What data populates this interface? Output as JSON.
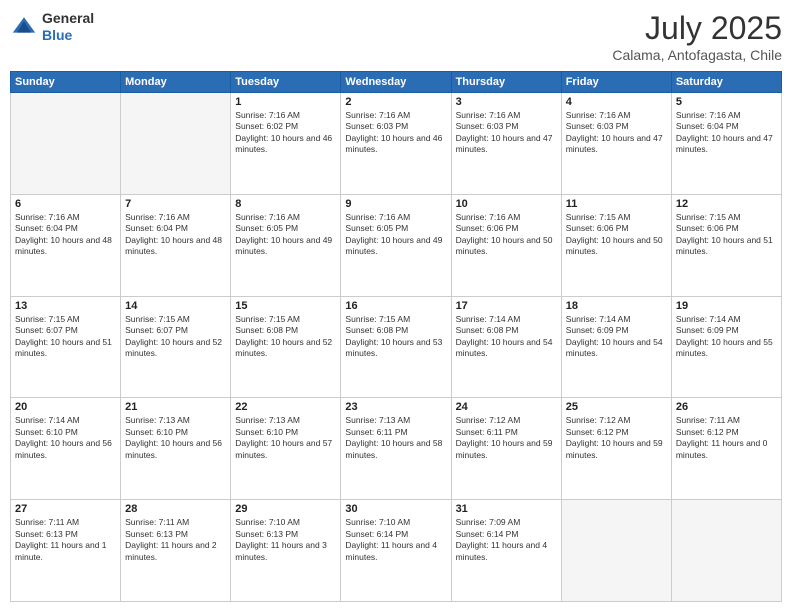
{
  "header": {
    "logo_general": "General",
    "logo_blue": "Blue",
    "month_year": "July 2025",
    "location": "Calama, Antofagasta, Chile"
  },
  "days_of_week": [
    "Sunday",
    "Monday",
    "Tuesday",
    "Wednesday",
    "Thursday",
    "Friday",
    "Saturday"
  ],
  "weeks": [
    [
      {
        "day": "",
        "empty": true
      },
      {
        "day": "",
        "empty": true
      },
      {
        "day": "1",
        "sunrise": "Sunrise: 7:16 AM",
        "sunset": "Sunset: 6:02 PM",
        "daylight": "Daylight: 10 hours and 46 minutes."
      },
      {
        "day": "2",
        "sunrise": "Sunrise: 7:16 AM",
        "sunset": "Sunset: 6:03 PM",
        "daylight": "Daylight: 10 hours and 46 minutes."
      },
      {
        "day": "3",
        "sunrise": "Sunrise: 7:16 AM",
        "sunset": "Sunset: 6:03 PM",
        "daylight": "Daylight: 10 hours and 47 minutes."
      },
      {
        "day": "4",
        "sunrise": "Sunrise: 7:16 AM",
        "sunset": "Sunset: 6:03 PM",
        "daylight": "Daylight: 10 hours and 47 minutes."
      },
      {
        "day": "5",
        "sunrise": "Sunrise: 7:16 AM",
        "sunset": "Sunset: 6:04 PM",
        "daylight": "Daylight: 10 hours and 47 minutes."
      }
    ],
    [
      {
        "day": "6",
        "sunrise": "Sunrise: 7:16 AM",
        "sunset": "Sunset: 6:04 PM",
        "daylight": "Daylight: 10 hours and 48 minutes."
      },
      {
        "day": "7",
        "sunrise": "Sunrise: 7:16 AM",
        "sunset": "Sunset: 6:04 PM",
        "daylight": "Daylight: 10 hours and 48 minutes."
      },
      {
        "day": "8",
        "sunrise": "Sunrise: 7:16 AM",
        "sunset": "Sunset: 6:05 PM",
        "daylight": "Daylight: 10 hours and 49 minutes."
      },
      {
        "day": "9",
        "sunrise": "Sunrise: 7:16 AM",
        "sunset": "Sunset: 6:05 PM",
        "daylight": "Daylight: 10 hours and 49 minutes."
      },
      {
        "day": "10",
        "sunrise": "Sunrise: 7:16 AM",
        "sunset": "Sunset: 6:06 PM",
        "daylight": "Daylight: 10 hours and 50 minutes."
      },
      {
        "day": "11",
        "sunrise": "Sunrise: 7:15 AM",
        "sunset": "Sunset: 6:06 PM",
        "daylight": "Daylight: 10 hours and 50 minutes."
      },
      {
        "day": "12",
        "sunrise": "Sunrise: 7:15 AM",
        "sunset": "Sunset: 6:06 PM",
        "daylight": "Daylight: 10 hours and 51 minutes."
      }
    ],
    [
      {
        "day": "13",
        "sunrise": "Sunrise: 7:15 AM",
        "sunset": "Sunset: 6:07 PM",
        "daylight": "Daylight: 10 hours and 51 minutes."
      },
      {
        "day": "14",
        "sunrise": "Sunrise: 7:15 AM",
        "sunset": "Sunset: 6:07 PM",
        "daylight": "Daylight: 10 hours and 52 minutes."
      },
      {
        "day": "15",
        "sunrise": "Sunrise: 7:15 AM",
        "sunset": "Sunset: 6:08 PM",
        "daylight": "Daylight: 10 hours and 52 minutes."
      },
      {
        "day": "16",
        "sunrise": "Sunrise: 7:15 AM",
        "sunset": "Sunset: 6:08 PM",
        "daylight": "Daylight: 10 hours and 53 minutes."
      },
      {
        "day": "17",
        "sunrise": "Sunrise: 7:14 AM",
        "sunset": "Sunset: 6:08 PM",
        "daylight": "Daylight: 10 hours and 54 minutes."
      },
      {
        "day": "18",
        "sunrise": "Sunrise: 7:14 AM",
        "sunset": "Sunset: 6:09 PM",
        "daylight": "Daylight: 10 hours and 54 minutes."
      },
      {
        "day": "19",
        "sunrise": "Sunrise: 7:14 AM",
        "sunset": "Sunset: 6:09 PM",
        "daylight": "Daylight: 10 hours and 55 minutes."
      }
    ],
    [
      {
        "day": "20",
        "sunrise": "Sunrise: 7:14 AM",
        "sunset": "Sunset: 6:10 PM",
        "daylight": "Daylight: 10 hours and 56 minutes."
      },
      {
        "day": "21",
        "sunrise": "Sunrise: 7:13 AM",
        "sunset": "Sunset: 6:10 PM",
        "daylight": "Daylight: 10 hours and 56 minutes."
      },
      {
        "day": "22",
        "sunrise": "Sunrise: 7:13 AM",
        "sunset": "Sunset: 6:10 PM",
        "daylight": "Daylight: 10 hours and 57 minutes."
      },
      {
        "day": "23",
        "sunrise": "Sunrise: 7:13 AM",
        "sunset": "Sunset: 6:11 PM",
        "daylight": "Daylight: 10 hours and 58 minutes."
      },
      {
        "day": "24",
        "sunrise": "Sunrise: 7:12 AM",
        "sunset": "Sunset: 6:11 PM",
        "daylight": "Daylight: 10 hours and 59 minutes."
      },
      {
        "day": "25",
        "sunrise": "Sunrise: 7:12 AM",
        "sunset": "Sunset: 6:12 PM",
        "daylight": "Daylight: 10 hours and 59 minutes."
      },
      {
        "day": "26",
        "sunrise": "Sunrise: 7:11 AM",
        "sunset": "Sunset: 6:12 PM",
        "daylight": "Daylight: 11 hours and 0 minutes."
      }
    ],
    [
      {
        "day": "27",
        "sunrise": "Sunrise: 7:11 AM",
        "sunset": "Sunset: 6:13 PM",
        "daylight": "Daylight: 11 hours and 1 minute."
      },
      {
        "day": "28",
        "sunrise": "Sunrise: 7:11 AM",
        "sunset": "Sunset: 6:13 PM",
        "daylight": "Daylight: 11 hours and 2 minutes."
      },
      {
        "day": "29",
        "sunrise": "Sunrise: 7:10 AM",
        "sunset": "Sunset: 6:13 PM",
        "daylight": "Daylight: 11 hours and 3 minutes."
      },
      {
        "day": "30",
        "sunrise": "Sunrise: 7:10 AM",
        "sunset": "Sunset: 6:14 PM",
        "daylight": "Daylight: 11 hours and 4 minutes."
      },
      {
        "day": "31",
        "sunrise": "Sunrise: 7:09 AM",
        "sunset": "Sunset: 6:14 PM",
        "daylight": "Daylight: 11 hours and 4 minutes."
      },
      {
        "day": "",
        "empty": true
      },
      {
        "day": "",
        "empty": true
      }
    ]
  ]
}
